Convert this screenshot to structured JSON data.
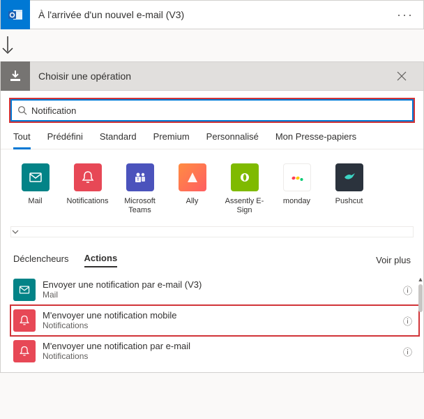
{
  "trigger": {
    "title": "À l'arrivée d'un nouvel e-mail (V3)"
  },
  "chooser": {
    "title": "Choisir une opération"
  },
  "search": {
    "value": "Notification"
  },
  "scope_tabs": {
    "items": [
      {
        "label": "Tout",
        "active": true
      },
      {
        "label": "Prédéfini"
      },
      {
        "label": "Standard"
      },
      {
        "label": "Premium"
      },
      {
        "label": "Personnalisé"
      },
      {
        "label": "Mon Presse-papiers"
      }
    ]
  },
  "connectors": [
    {
      "label": "Mail",
      "icon": "mail",
      "color": "teal"
    },
    {
      "label": "Notifications",
      "icon": "bell",
      "color": "red"
    },
    {
      "label": "Microsoft Teams",
      "icon": "teams",
      "color": "purple"
    },
    {
      "label": "Ally",
      "icon": "ally",
      "color": "orange"
    },
    {
      "label": "Assently E-Sign",
      "icon": "assently",
      "color": "green"
    },
    {
      "label": "monday",
      "icon": "monday",
      "color": "white"
    },
    {
      "label": "Pushcut",
      "icon": "pushcut",
      "color": "dark"
    }
  ],
  "section_tabs": {
    "triggers": "Déclencheurs",
    "actions": "Actions",
    "more": "Voir plus"
  },
  "actions": [
    {
      "title": "Envoyer une notification par e-mail (V3)",
      "sub": "Mail",
      "icon": "mail",
      "color": "teal"
    },
    {
      "title": "M'envoyer une notification mobile",
      "sub": "Notifications",
      "icon": "bell",
      "color": "red",
      "highlight": true
    },
    {
      "title": "M'envoyer une notification par e-mail",
      "sub": "Notifications",
      "icon": "bell",
      "color": "red"
    }
  ]
}
